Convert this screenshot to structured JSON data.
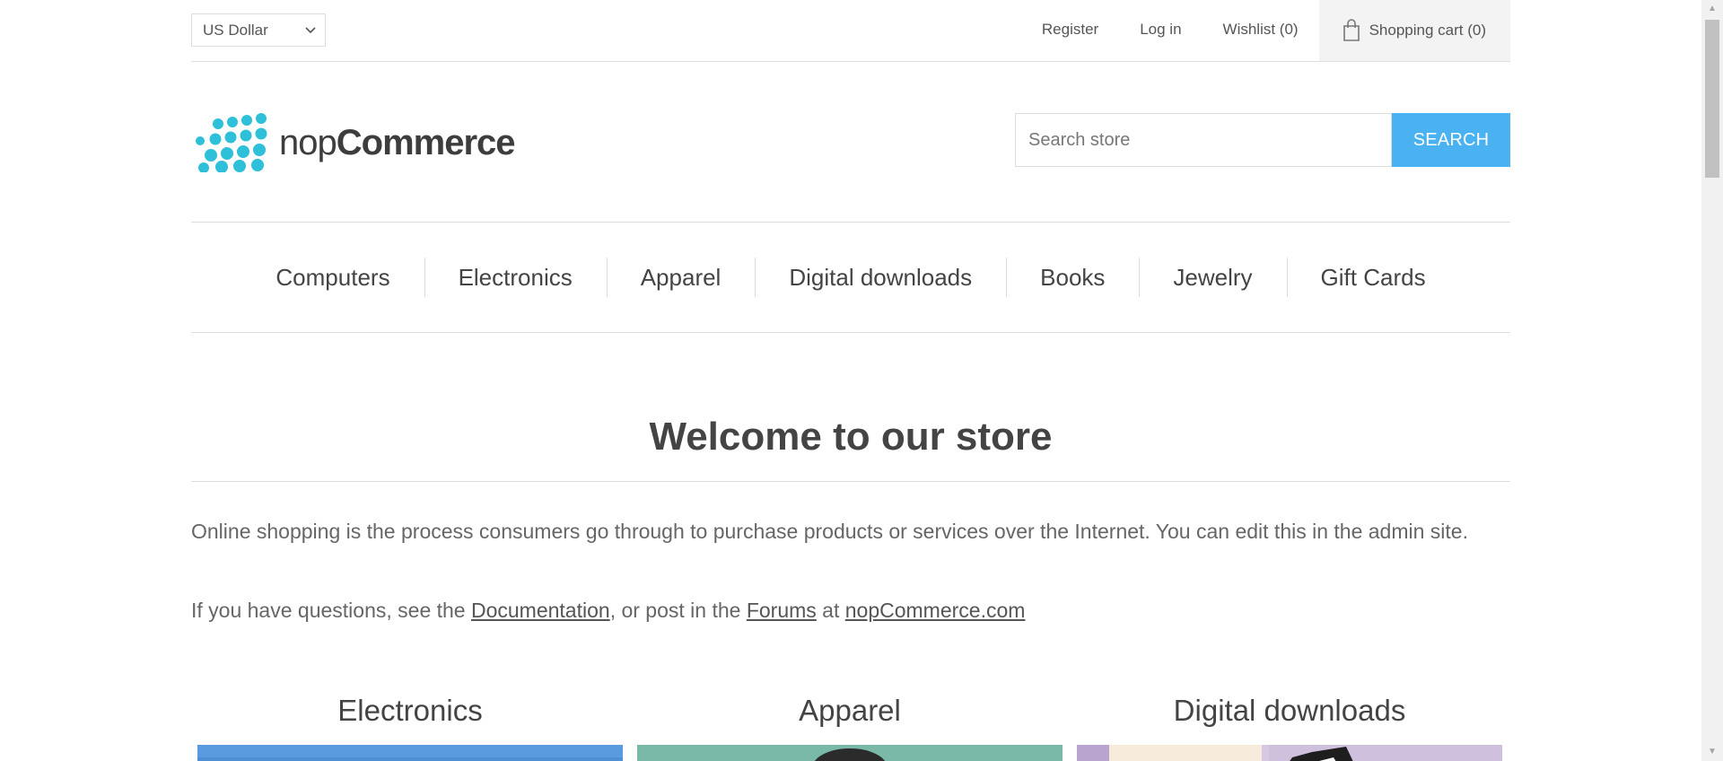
{
  "header": {
    "currency": "US Dollar",
    "links": {
      "register": "Register",
      "login": "Log in",
      "wishlist": "Wishlist (0)",
      "cart": "Shopping cart (0)"
    }
  },
  "logo": {
    "text_light": "nop",
    "text_bold": "Commerce"
  },
  "search": {
    "placeholder": "Search store",
    "button_label": "SEARCH"
  },
  "menu": {
    "items": [
      "Computers",
      "Electronics",
      "Apparel",
      "Digital downloads",
      "Books",
      "Jewelry",
      "Gift Cards"
    ]
  },
  "welcome": {
    "title": "Welcome to our store",
    "paragraph1": "Online shopping is the process consumers go through to purchase products or services over the Internet. You can edit this in the admin site.",
    "p2_prefix": "If you have questions, see the ",
    "p2_link1": "Documentation",
    "p2_mid": ", or post in the ",
    "p2_link2": "Forums",
    "p2_at": " at ",
    "p2_link3": "nopCommerce.com"
  },
  "categories": [
    "Electronics",
    "Apparel",
    "Digital downloads"
  ],
  "colors": {
    "accent": "#4ab2f1",
    "logo_dots": "#2fc0d9",
    "divider": "#dddddd"
  }
}
